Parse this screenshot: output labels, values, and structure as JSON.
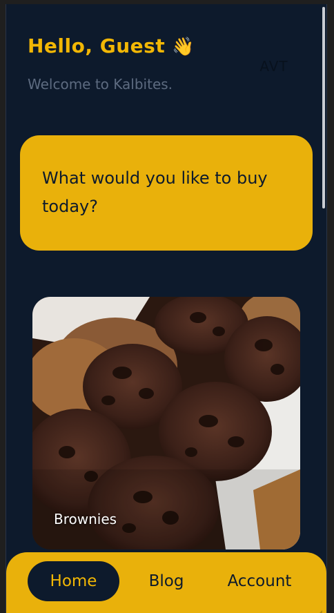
{
  "header": {
    "greeting": "Hello, Guest",
    "wave_emoji": "👋",
    "subtitle": "Welcome to Kalbites.",
    "avatar_text": "AVT"
  },
  "prompt_card": {
    "text": "What would you like to buy today?"
  },
  "products": [
    {
      "label": "Brownies",
      "image": "brownie-muffins-photo"
    }
  ],
  "bottom_nav": {
    "items": [
      {
        "label": "Home",
        "active": true
      },
      {
        "label": "Blog",
        "active": false
      },
      {
        "label": "Account",
        "active": false
      }
    ]
  },
  "colors": {
    "background": "#0d1a2c",
    "accent": "#e9b10b",
    "greeting": "#f2b705",
    "subtitle": "#5d6b80"
  }
}
